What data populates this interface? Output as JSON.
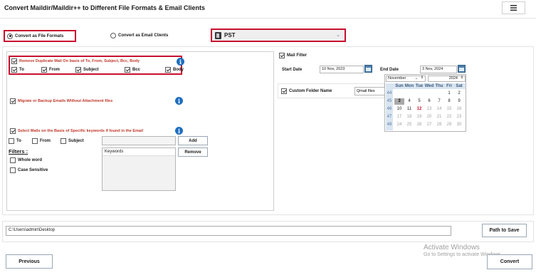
{
  "header": {
    "title": "Convert Maildir/Maildir++ to Different File Formats & Email Clients",
    "menu_icon": "hamburger-menu-icon"
  },
  "mode": {
    "file_formats_label": "Convert as File Formats",
    "email_clients_label": "Convert as Email Clients",
    "selected": "file_formats"
  },
  "format_select": {
    "value": "PST",
    "icon": "pst-file-icon",
    "arrow_icon": "chevron-down-icon"
  },
  "options": {
    "remove_duplicates": {
      "label": "Remove Duplicate Mail On basis of To, From, Subject, Bcc, Body",
      "checked": true,
      "fields": [
        {
          "label": "To",
          "checked": true
        },
        {
          "label": "From",
          "checked": true
        },
        {
          "label": "Subject",
          "checked": true
        },
        {
          "label": "Bcc",
          "checked": true
        },
        {
          "label": "Body",
          "checked": true
        }
      ]
    },
    "migrate_without_attachments": {
      "label": "Migrate or Backup Emails Without Attachment files",
      "checked": true
    },
    "keywords": {
      "label": "Select Mails on the Basis of Specific keywords if found in the Email",
      "checked": true,
      "fields": [
        {
          "label": "To",
          "checked": false
        },
        {
          "label": "From",
          "checked": false
        },
        {
          "label": "Subject",
          "checked": false
        }
      ],
      "input_value": "",
      "add_label": "Add",
      "remove_label": "Remove",
      "list_header": "Keywords"
    },
    "filters": {
      "title": "Filters :",
      "whole_word": "Whole word",
      "case_sensitive": "Case Sensitive"
    }
  },
  "mail_filter": {
    "label": "Mail Filter",
    "checked": true,
    "start_label": "Start Date",
    "start_value": "10 Nov, 2023",
    "end_label": "End Date",
    "end_value": "3 Nov, 2024",
    "calendar_icon": "calendar-icon"
  },
  "custom_folder": {
    "label": "Custom Folder Name",
    "checked": true,
    "value": "Qmail files"
  },
  "calendar": {
    "month": "November",
    "year": "2024",
    "weekdays": [
      "Sun",
      "Mon",
      "Tue",
      "Wed",
      "Thu",
      "Fri",
      "Sat"
    ],
    "weeks": [
      {
        "num": "44",
        "days": [
          "",
          "",
          "",
          "",
          "",
          "1",
          "2"
        ]
      },
      {
        "num": "45",
        "days": [
          "3",
          "4",
          "5",
          "6",
          "7",
          "8",
          "9"
        ]
      },
      {
        "num": "46",
        "days": [
          "10",
          "11",
          "12",
          "13",
          "14",
          "15",
          "16"
        ]
      },
      {
        "num": "47",
        "days": [
          "17",
          "18",
          "19",
          "20",
          "21",
          "22",
          "23"
        ]
      },
      {
        "num": "48",
        "days": [
          "24",
          "25",
          "26",
          "27",
          "28",
          "29",
          "30"
        ]
      }
    ],
    "selected_day": "3",
    "today_day": "12"
  },
  "path": {
    "value": "C:\\Users\\admin\\Desktop",
    "button_label": "Path to Save"
  },
  "footer": {
    "previous_label": "Previous",
    "convert_label": "Convert"
  },
  "watermark": {
    "line1": "Activate Windows",
    "line2": "Go to Settings to activate Windows."
  },
  "colors": {
    "highlight": "#c8102e",
    "info_blue": "#1f6fbf",
    "calendar_header": "#d9e5f1"
  }
}
